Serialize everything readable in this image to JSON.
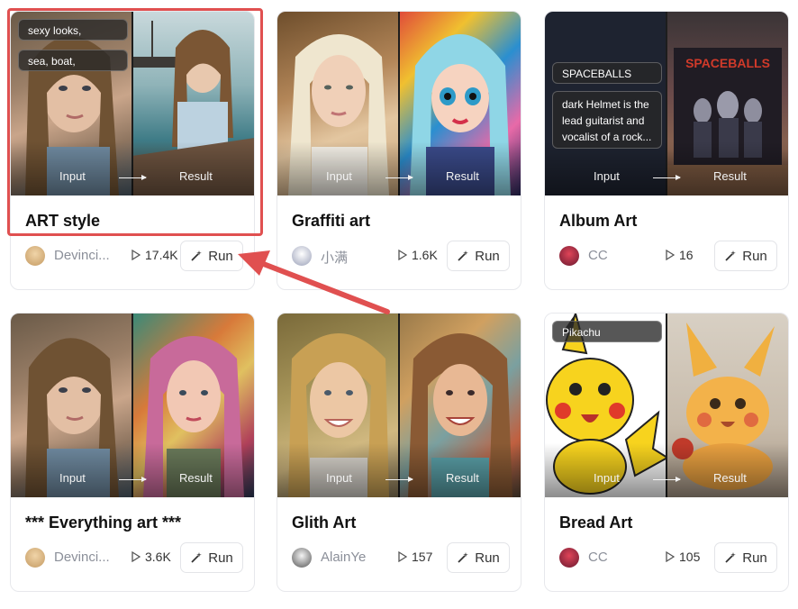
{
  "io": {
    "input_label": "Input",
    "result_label": "Result"
  },
  "cards": [
    {
      "title": "ART style",
      "author": "Devinci...",
      "plays": "17.4K",
      "run_label": "Run",
      "tags": [
        "sexy looks,",
        "sea, boat,"
      ],
      "avatar_color": "#d9b98a"
    },
    {
      "title": "Graffiti art",
      "author": "小满",
      "plays": "1.6K",
      "run_label": "Run",
      "tags": [],
      "avatar_color": "#6b6f8a"
    },
    {
      "title": "Album Art",
      "author": "CC",
      "plays": "16",
      "run_label": "Run",
      "tags": [
        "SPACEBALLS",
        "dark Helmet is the lead guitarist and vocalist of a rock..."
      ],
      "avatar_color": "#c0283a",
      "album_text": "SPACEBALLS"
    },
    {
      "title": "*** Everything art ***",
      "author": "Devinci...",
      "plays": "3.6K",
      "run_label": "Run",
      "tags": [],
      "avatar_color": "#d9b98a"
    },
    {
      "title": "Glith Art",
      "author": "AlainYe",
      "plays": "157",
      "run_label": "Run",
      "tags": [],
      "avatar_color": "#7a7a7a"
    },
    {
      "title": "Bread Art",
      "author": "CC",
      "plays": "105",
      "run_label": "Run",
      "tags": [
        "Pikachu"
      ],
      "avatar_color": "#c0283a"
    }
  ],
  "colors": {
    "highlight": "#e05050",
    "arrow": "#e05050"
  }
}
